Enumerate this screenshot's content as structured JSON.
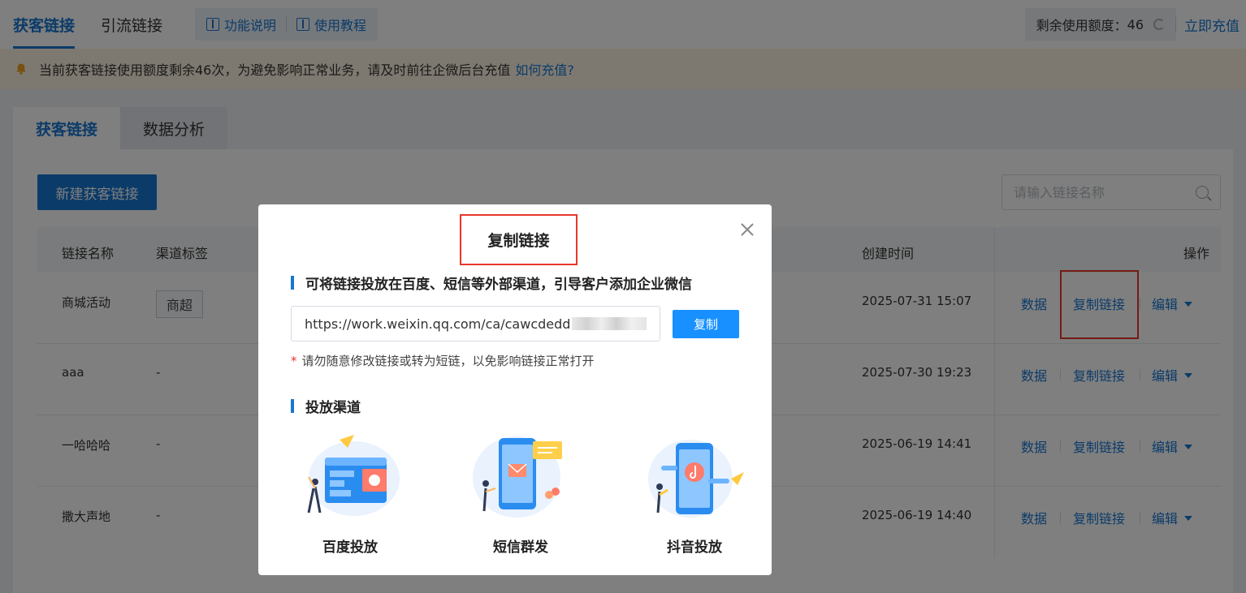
{
  "header": {
    "tabs": [
      {
        "label": "获客链接",
        "active": true
      },
      {
        "label": "引流链接",
        "active": false
      }
    ],
    "doc_links": [
      "功能说明",
      "使用教程"
    ],
    "quota_label": "剩余使用额度：",
    "quota_value": "46",
    "recharge_label": "立即充值"
  },
  "notice": {
    "text": "当前获客链接使用额度剩余46次，为避免影响正常业务，请及时前往企微后台充值",
    "link": "如何充值?"
  },
  "main": {
    "tabs": [
      {
        "label": "获客链接",
        "active": true
      },
      {
        "label": "数据分析",
        "active": false
      }
    ],
    "new_button": "新建获客链接",
    "search_placeholder": "请输入链接名称"
  },
  "table": {
    "columns": [
      "链接名称",
      "渠道标签",
      "创建时间",
      "操作"
    ],
    "rows": [
      {
        "name": "商城活动",
        "tag": "商超",
        "created": "2025-07-31 15:07"
      },
      {
        "name": "aaa",
        "tag": "-",
        "created": "2025-07-30 19:23"
      },
      {
        "name": "一哈哈哈",
        "tag": "-",
        "created": "2025-06-19 14:41"
      },
      {
        "name": "撒大声地",
        "tag": "-",
        "created": "2025-06-19 14:40"
      }
    ],
    "actions": [
      "数据",
      "复制链接",
      "编辑"
    ]
  },
  "modal": {
    "title": "复制链接",
    "section1": "可将链接投放在百度、短信等外部渠道，引导客户添加企业微信",
    "url": "https://work.weixin.qq.com/ca/cawcdedd",
    "copy_button": "复制",
    "warning": "请勿随意修改链接或转为短链，以免影响链接正常打开",
    "section2": "投放渠道",
    "channels": [
      "百度投放",
      "短信群发",
      "抖音投放"
    ]
  },
  "colors": {
    "primary": "#1677d2",
    "highlight": "#e8372d",
    "notice_bg": "#fdf3e1"
  }
}
